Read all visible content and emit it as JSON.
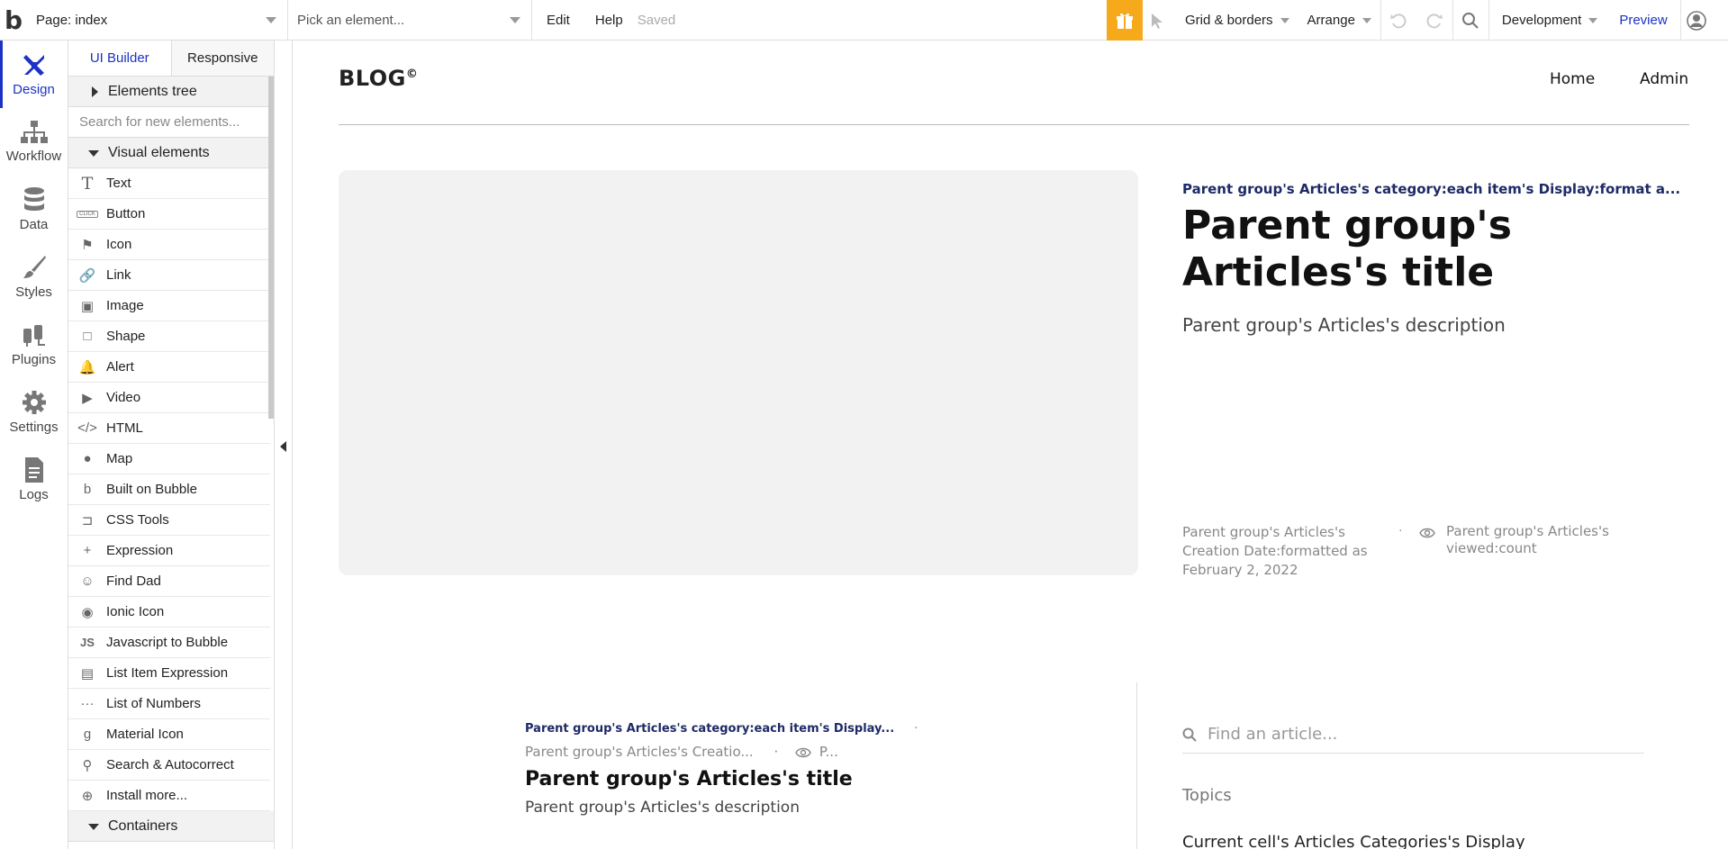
{
  "topbar": {
    "logo": "b",
    "page_select": "Page: index",
    "element_picker_placeholder": "Pick an element...",
    "edit": "Edit",
    "help": "Help",
    "saved": "Saved",
    "grid_borders": "Grid & borders",
    "arrange": "Arrange",
    "environment": "Development",
    "preview": "Preview",
    "accent_color": "#f6a91b",
    "link_color": "#1c32c6"
  },
  "rail": {
    "items": [
      {
        "label": "Design",
        "icon": "design-icon"
      },
      {
        "label": "Workflow",
        "icon": "workflow-icon"
      },
      {
        "label": "Data",
        "icon": "database-icon"
      },
      {
        "label": "Styles",
        "icon": "brush-icon"
      },
      {
        "label": "Plugins",
        "icon": "plug-icon"
      },
      {
        "label": "Settings",
        "icon": "gear-icon"
      },
      {
        "label": "Logs",
        "icon": "document-icon"
      }
    ]
  },
  "panel": {
    "tab_ui_builder": "UI Builder",
    "tab_responsive": "Responsive",
    "elements_tree": "Elements tree",
    "search_placeholder": "Search for new elements...",
    "visual_elements": "Visual elements",
    "containers": "Containers",
    "items": [
      {
        "label": "Text",
        "icon": "T"
      },
      {
        "label": "Button",
        "icon": "CLICK"
      },
      {
        "label": "Icon",
        "icon": "⚑"
      },
      {
        "label": "Link",
        "icon": "🔗"
      },
      {
        "label": "Image",
        "icon": "▣"
      },
      {
        "label": "Shape",
        "icon": "□"
      },
      {
        "label": "Alert",
        "icon": "🔔"
      },
      {
        "label": "Video",
        "icon": "▶"
      },
      {
        "label": "HTML",
        "icon": "</>"
      },
      {
        "label": "Map",
        "icon": "●"
      },
      {
        "label": "Built on Bubble",
        "icon": "b"
      },
      {
        "label": "CSS Tools",
        "icon": "⊐"
      },
      {
        "label": "Expression",
        "icon": "+"
      },
      {
        "label": "Find Dad",
        "icon": "☺"
      },
      {
        "label": "Ionic Icon",
        "icon": "◉"
      },
      {
        "label": "Javascript to Bubble",
        "icon": "JS"
      },
      {
        "label": "List Item Expression",
        "icon": "▤"
      },
      {
        "label": "List of Numbers",
        "icon": "···"
      },
      {
        "label": "Material Icon",
        "icon": "g"
      },
      {
        "label": "Search & Autocorrect",
        "icon": "⚲"
      },
      {
        "label": "Install more...",
        "icon": "⊕"
      }
    ]
  },
  "canvas": {
    "logo": "BLOG",
    "logo_mark": "©",
    "nav_home": "Home",
    "nav_admin": "Admin",
    "hero": {
      "category": "Parent group's Articles's category:each item's Display:format a...",
      "title": "Parent group's Articles's title",
      "description": "Parent group's Articles's description",
      "date": "Parent group's Articles's Creation Date:formatted as February 2, 2022",
      "dot": "·",
      "views": "Parent group's Articles's viewed:count"
    },
    "card": {
      "category": "Parent group's Articles's category:each item's Display...",
      "category_dot": "·",
      "meta_date": "Parent group's Articles's Creatio...",
      "meta_dot": "·",
      "meta_views": "P...",
      "title": "Parent group's Articles's title",
      "description": "Parent group's Articles's description"
    },
    "find_placeholder": "Find an article...",
    "topics": "Topics",
    "cell_category": "Current cell's Articles Categories's Display"
  }
}
